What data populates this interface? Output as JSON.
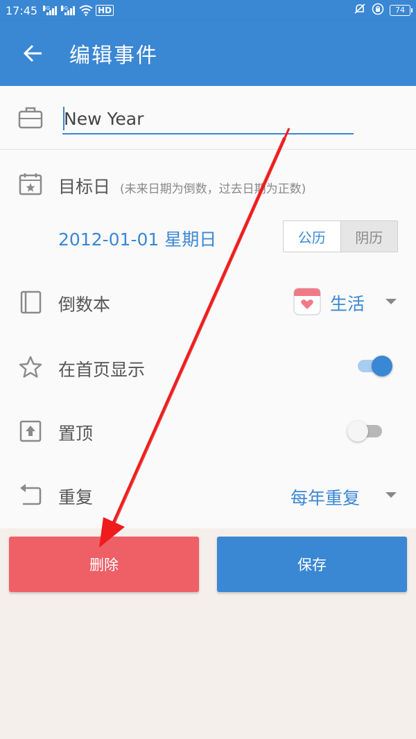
{
  "status_bar": {
    "time": "17:45",
    "net1": "4G",
    "net2": "4G",
    "hd": "HD",
    "battery": "74"
  },
  "header": {
    "title": "编辑事件"
  },
  "event": {
    "name_value": "New Year",
    "target_label": "目标日",
    "target_hint": "(未来日期为倒数，过去日期为正数)",
    "date_value": "2012-01-01 星期日",
    "calendar_solar": "公历",
    "calendar_lunar": "阴历",
    "book_label": "倒数本",
    "category": "生活",
    "homepage_label": "在首页显示",
    "homepage_enabled": true,
    "pin_label": "置顶",
    "pin_enabled": false,
    "repeat_label": "重复",
    "repeat_value": "每年重复"
  },
  "actions": {
    "delete": "删除",
    "save": "保存"
  },
  "colors": {
    "primary": "#3a87d4",
    "delete": "#ef5f66",
    "annotation_arrow": "#ee1c1c"
  }
}
